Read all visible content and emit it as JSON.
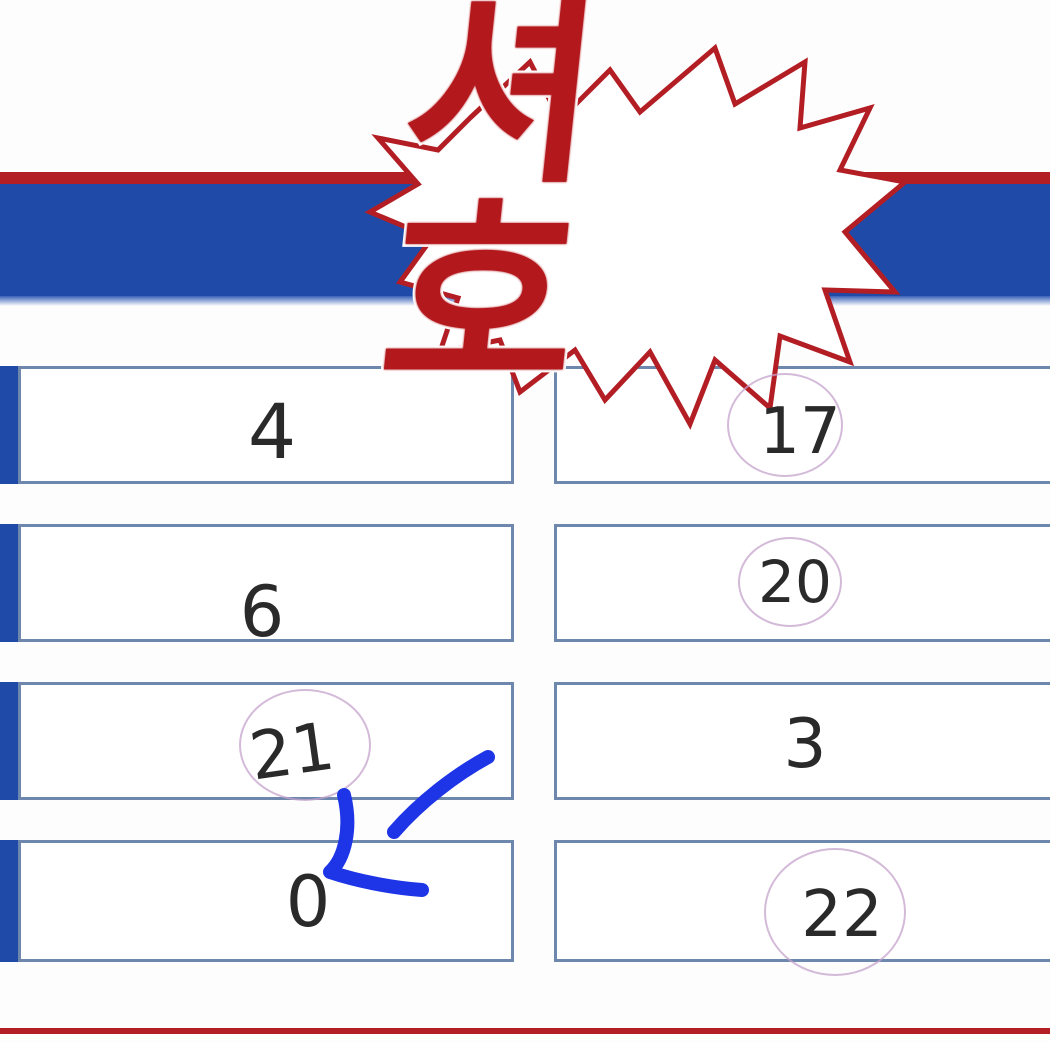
{
  "title": "셔호",
  "colors": {
    "header_blue": "#1f4aa8",
    "header_red": "#b31e24",
    "cell_border": "#6d87ad",
    "ink": "#2a2a2a",
    "circle_pink": "#c6a3cc",
    "arrow_blue": "#1d35e6"
  },
  "left_column": [
    "4",
    "6",
    "21",
    "0"
  ],
  "right_column": [
    "17",
    "20",
    "3",
    "22"
  ],
  "circled": {
    "left": [
      false,
      false,
      true,
      false
    ],
    "right": [
      true,
      true,
      false,
      true
    ]
  },
  "annotation": {
    "type": "hand-drawn-arrow",
    "points_to": "0"
  }
}
